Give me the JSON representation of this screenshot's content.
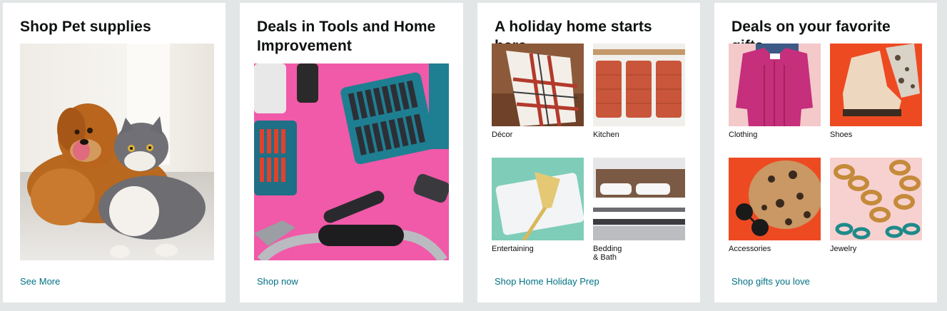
{
  "cards": [
    {
      "title": "Shop Pet supplies",
      "link": "See More",
      "image": "dog-and-cat-photo"
    },
    {
      "title": "Deals in Tools and Home Improvement",
      "link": "Shop now",
      "image": "tool-bits-photo"
    },
    {
      "title": "A holiday home starts here",
      "link": "Shop Home Holiday Prep",
      "tiles": [
        "Décor",
        "Kitchen",
        "Entertaining",
        "Bedding & Bath"
      ]
    },
    {
      "title": "Deals on your favorite gifts",
      "link": "Shop gifts you love",
      "tiles": [
        "Clothing",
        "Shoes",
        "Accessories",
        "Jewelry"
      ]
    }
  ],
  "colors": {
    "background": "#e3e6e6",
    "link": "#007185",
    "tools_background": "#f05aa8",
    "gift_orange": "#ee4a22"
  }
}
